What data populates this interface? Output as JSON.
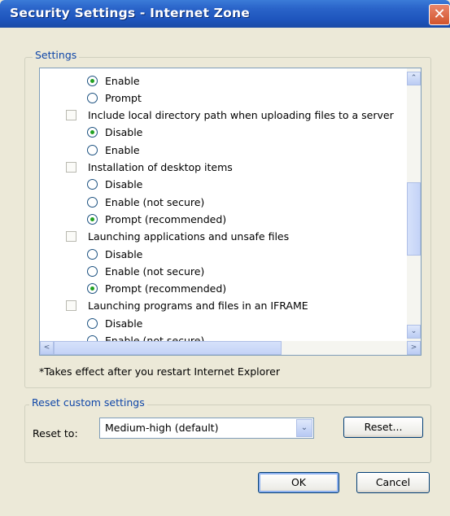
{
  "window": {
    "title": "Security Settings - Internet Zone",
    "close_glyph": "✕"
  },
  "settings_group_label": "Settings",
  "settings_list": [
    {
      "type": "radio",
      "label": "Enable",
      "checked": true
    },
    {
      "type": "radio",
      "label": "Prompt",
      "checked": false
    },
    {
      "type": "header",
      "label": "Include local directory path when uploading files to a server"
    },
    {
      "type": "radio",
      "label": "Disable",
      "checked": true
    },
    {
      "type": "radio",
      "label": "Enable",
      "checked": false
    },
    {
      "type": "header",
      "label": "Installation of desktop items"
    },
    {
      "type": "radio",
      "label": "Disable",
      "checked": false
    },
    {
      "type": "radio",
      "label": "Enable (not secure)",
      "checked": false
    },
    {
      "type": "radio",
      "label": "Prompt (recommended)",
      "checked": true
    },
    {
      "type": "header",
      "label": "Launching applications and unsafe files"
    },
    {
      "type": "radio",
      "label": "Disable",
      "checked": false
    },
    {
      "type": "radio",
      "label": "Enable (not secure)",
      "checked": false
    },
    {
      "type": "radio",
      "label": "Prompt (recommended)",
      "checked": true
    },
    {
      "type": "header",
      "label": "Launching programs and files in an IFRAME"
    },
    {
      "type": "radio",
      "label": "Disable",
      "checked": false
    },
    {
      "type": "radio",
      "label": "Enable (not secure)",
      "checked": false
    }
  ],
  "scroll": {
    "up": "⌃",
    "down": "⌄",
    "left": "<",
    "right": ">"
  },
  "restart_note": "*Takes effect after you restart Internet Explorer",
  "reset_group_label": "Reset custom settings",
  "reset_to_label": "Reset to:",
  "reset_select_value": "Medium-high (default)",
  "reset_select_arrow": "⌄",
  "reset_button_label": "Reset...",
  "ok_label": "OK",
  "cancel_label": "Cancel"
}
